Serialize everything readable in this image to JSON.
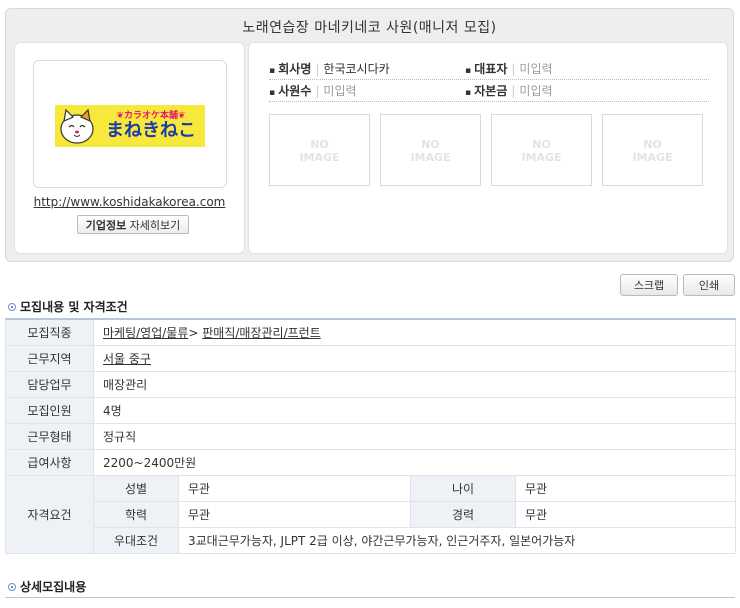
{
  "header": {
    "title": "노래연습장 마네키네코 사원(매니저 모집)"
  },
  "company": {
    "logo": {
      "small_text": "❦カラオケ本舗❦",
      "big_text": "まねきねこ"
    },
    "url": "http://www.koshidakakorea.com",
    "detail_button": {
      "bold": "기업정보",
      "rest": " 자세히보기"
    },
    "info": [
      {
        "label": "회사명",
        "value": "한국코시다카"
      },
      {
        "label": "대표자",
        "value": "미입력"
      },
      {
        "label": "사원수",
        "value": "미입력"
      },
      {
        "label": "자본금",
        "value": "미입력"
      }
    ],
    "no_image": {
      "line1": "NO",
      "line2": "IMAGE"
    }
  },
  "actions": {
    "scrap": "스크랩",
    "print": "인쇄"
  },
  "section1": {
    "title": "모집내용 및 자격조건"
  },
  "table": {
    "job_type": {
      "label": "모집직종",
      "parts": [
        "마케팅/영업/물류",
        "> ",
        "판매직/매장관리/프런트"
      ]
    },
    "location": {
      "label": "근무지역",
      "value": "서울 중구"
    },
    "duty": {
      "label": "담당업무",
      "value": "매장관리"
    },
    "headcount": {
      "label": "모집인원",
      "value": "4명"
    },
    "employment": {
      "label": "근무형태",
      "value": "정규직"
    },
    "salary": {
      "label": "급여사항",
      "value": "2200~2400만원"
    },
    "qualification": {
      "label": "자격요건",
      "gender": {
        "label": "성별",
        "value": "무관"
      },
      "age": {
        "label": "나이",
        "value": "무관"
      },
      "education": {
        "label": "학력",
        "value": "무관"
      },
      "career": {
        "label": "경력",
        "value": "무관"
      },
      "preference": {
        "label": "우대조건",
        "value": "3교대근무가능자, JLPT 2급 이상, 야간근무가능자, 인근거주자, 일본어가능자"
      }
    }
  },
  "section2": {
    "title": "상세모집내용"
  }
}
